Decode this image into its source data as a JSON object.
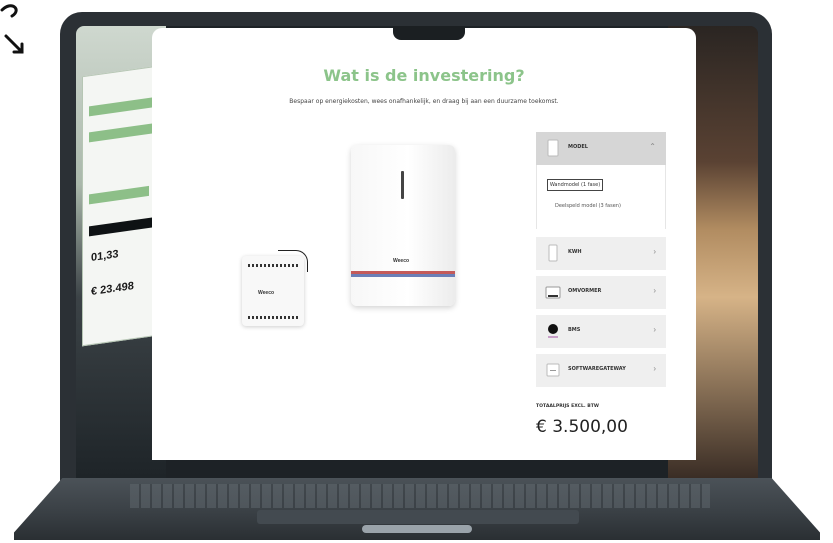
{
  "modal": {
    "title": "Wat is de investering?",
    "subtitle": "Bespaar op energiekosten, wees onafhankelijk, en draag bij aan een duurzame toekomst."
  },
  "options": {
    "model": {
      "label": "MODEL",
      "chevron": "⌃"
    },
    "variants": [
      "Wandmodel (1 fase)",
      "Deelspeld model (3 fasen)"
    ],
    "kwh": {
      "label": "KWH",
      "chevron": "›"
    },
    "omvormer": {
      "label": "OMVORMER",
      "chevron": "›"
    },
    "bms": {
      "label": "BMS",
      "chevron": "›"
    },
    "software": {
      "label": "SOFTWAREGATEWAY",
      "chevron": "›"
    }
  },
  "total": {
    "label": "TOTAALPRIJS EXCL. BTW",
    "value": "€ 3.500,00"
  },
  "background_doc": {
    "value_1": "01,33",
    "value_2": "€ 23.498"
  },
  "product": {
    "battery_logo": "Weeco",
    "inverter_logo": "Weeco"
  },
  "colors": {
    "accent_green": "#8cc48a",
    "laptop_body": "#2b3035"
  },
  "icons": [
    "arrow-curl-icon",
    "chevron-up-icon",
    "chevron-right-icon"
  ]
}
